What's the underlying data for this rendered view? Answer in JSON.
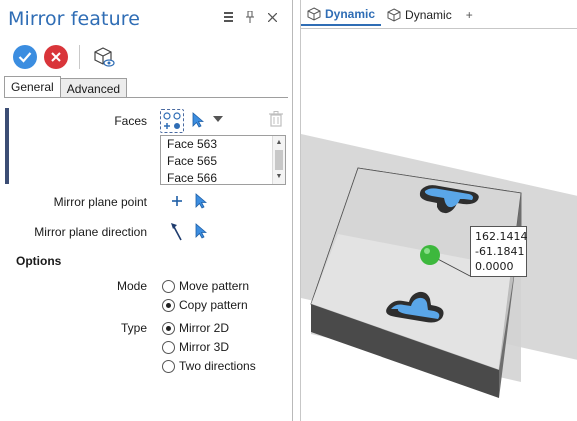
{
  "panel": {
    "title": "Mirror feature",
    "title_tools": [
      "menu-icon",
      "pin-icon",
      "close-icon"
    ],
    "actions": {
      "ok": "ok-icon",
      "cancel": "cancel-icon",
      "preview": "preview-icon"
    },
    "tabs": [
      {
        "label": "General",
        "active": true
      },
      {
        "label": "Advanced",
        "active": false
      }
    ],
    "faces": {
      "label": "Faces",
      "items": [
        "Face 563",
        "Face 565",
        "Face 566"
      ]
    },
    "mirror_plane_point": {
      "label": "Mirror plane point"
    },
    "mirror_plane_direction": {
      "label": "Mirror plane direction"
    },
    "options": {
      "title": "Options",
      "mode": {
        "label": "Mode",
        "choices": [
          {
            "label": "Move pattern",
            "checked": false
          },
          {
            "label": "Copy pattern",
            "checked": true
          }
        ]
      },
      "type": {
        "label": "Type",
        "choices": [
          {
            "label": "Mirror 2D",
            "checked": true
          },
          {
            "label": "Mirror 3D",
            "checked": false
          },
          {
            "label": "Two directions",
            "checked": false
          }
        ]
      }
    }
  },
  "viewport": {
    "tabs": [
      {
        "label": "Dynamic",
        "active": true
      },
      {
        "label": "Dynamic",
        "active": false
      }
    ],
    "add_tab": "+",
    "coordinates": [
      "162.1414",
      "-61.1841",
      "0.0000"
    ],
    "colors": {
      "accent": "#2f6db5",
      "ok": "#3b8de0",
      "cancel": "#d9353a",
      "point": "#3db83d"
    }
  }
}
